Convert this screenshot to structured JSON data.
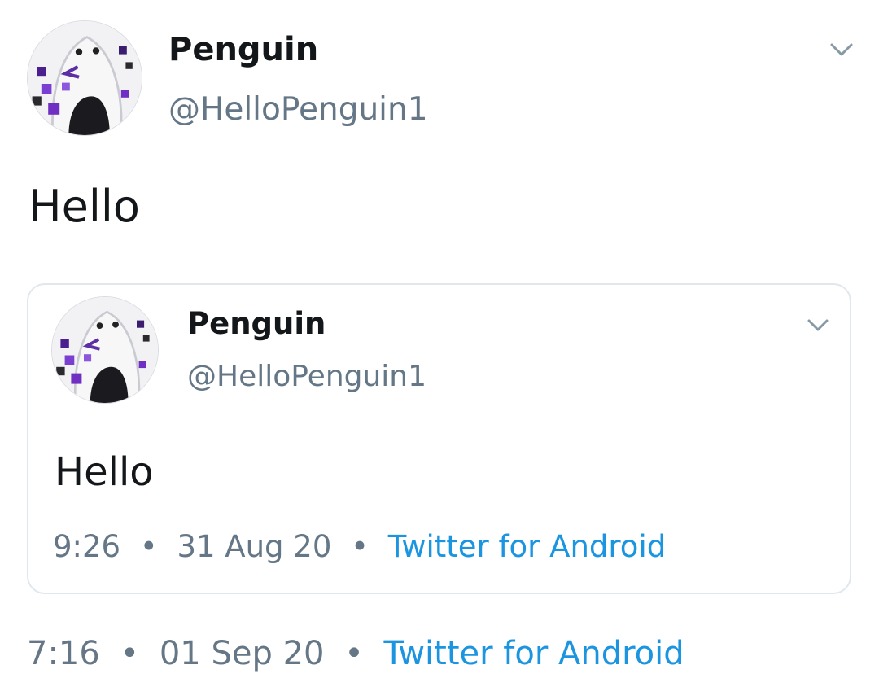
{
  "tweet": {
    "author": {
      "name": "Penguin",
      "handle": "@HelloPenguin1"
    },
    "text": "Hello",
    "time": "7:16",
    "date": "01 Sep 20",
    "source": "Twitter for Android",
    "separator": "•"
  },
  "quoted_tweet": {
    "author": {
      "name": "Penguin",
      "handle": "@HelloPenguin1"
    },
    "text": "Hello",
    "time": "9:26",
    "date": "31 Aug 20",
    "source": "Twitter for Android",
    "separator": "•"
  },
  "icons": {
    "menu": "chevron-down-icon",
    "avatar": "penguin-avatar"
  },
  "colors": {
    "link": "#1b95e0",
    "secondary_text": "#657786",
    "primary_text": "#14171a",
    "border": "#e1e8ed"
  }
}
